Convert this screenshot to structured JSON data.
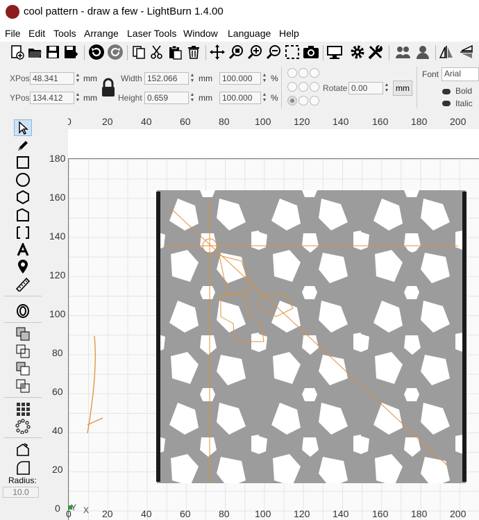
{
  "window": {
    "title": "cool pattern - draw a few - LightBurn 1.4.00"
  },
  "menu": [
    "File",
    "Edit",
    "Tools",
    "Arrange",
    "Laser Tools",
    "Window",
    "Language",
    "Help"
  ],
  "toolbar_icons": [
    "new-file-icon",
    "open-folder-icon",
    "save-icon",
    "save-as-icon",
    "undo-icon",
    "redo-icon",
    "copy-icon",
    "cut-icon",
    "paste-icon",
    "delete-icon",
    "move-icon",
    "zoom-selected-icon",
    "zoom-in-icon",
    "zoom-out-icon",
    "frame-select-icon",
    "camera-icon",
    "monitor-icon",
    "settings-icon",
    "tools-icon",
    "group-icon",
    "user-icon",
    "mirror-icon",
    "flip-icon"
  ],
  "props": {
    "xpos_label": "XPos",
    "xpos": "48.341",
    "ypos_label": "YPos",
    "ypos": "134.412",
    "unit": "mm",
    "width_label": "Width",
    "width": "152.066",
    "height_label": "Height",
    "height": "0.659",
    "scale_w": "100.000",
    "scale_h": "100.000",
    "percent": "%",
    "rotate_label": "Rotate",
    "rotate": "0.00",
    "rotate_unit": "mm",
    "font_label": "Font",
    "font": "Arial",
    "bold": "Bold",
    "italic": "Italic"
  },
  "left_tools": {
    "radius_label": "Radius:",
    "radius": "10.0"
  },
  "rulers": {
    "top": [
      "0",
      "20",
      "40",
      "60",
      "80",
      "100",
      "120",
      "140",
      "160",
      "180",
      "200"
    ],
    "top_corner": "200",
    "left": [
      "180",
      "160",
      "140",
      "120",
      "100",
      "80",
      "60",
      "40",
      "20",
      "0"
    ],
    "bottom": [
      "0",
      "20",
      "40",
      "60",
      "80",
      "100",
      "120",
      "140",
      "160",
      "180",
      "200"
    ],
    "axis_x": "X",
    "axis_y": "Y"
  }
}
